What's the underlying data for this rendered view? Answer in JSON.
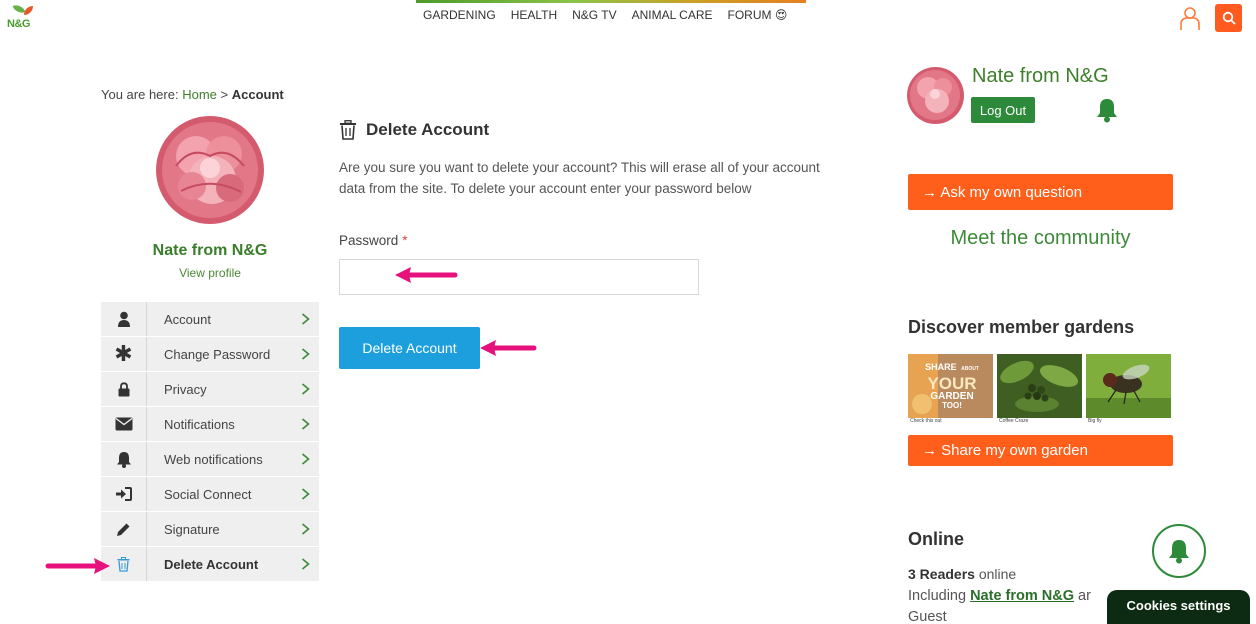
{
  "logo": {
    "text": "N&G"
  },
  "nav": {
    "items": [
      "GARDENING",
      "HEALTH",
      "N&G TV",
      "ANIMAL CARE",
      "FORUM 😍"
    ]
  },
  "breadcrumb": {
    "prefix": "You are here:",
    "home": "Home",
    "separator": ">",
    "current": "Account"
  },
  "profile": {
    "name": "Nate from N&G",
    "view_profile": "View profile"
  },
  "side_menu": [
    {
      "label": "Account",
      "icon": "user-icon"
    },
    {
      "label": "Change Password",
      "icon": "asterisk-icon"
    },
    {
      "label": "Privacy",
      "icon": "lock-icon"
    },
    {
      "label": "Notifications",
      "icon": "envelope-icon"
    },
    {
      "label": "Web notifications",
      "icon": "bell-icon"
    },
    {
      "label": "Social Connect",
      "icon": "sign-in-icon"
    },
    {
      "label": "Signature",
      "icon": "pencil-icon"
    },
    {
      "label": "Delete Account",
      "icon": "trash-icon",
      "active": true
    }
  ],
  "main": {
    "title": "Delete Account",
    "description": "Are you sure you want to delete your account? This will erase all of your account data from the site. To delete your account enter your password below",
    "password_label": "Password",
    "password_required": "*",
    "password_value": "",
    "delete_button": "Delete Account"
  },
  "sidebar": {
    "user_name": "Nate from N&G",
    "logout": "Log Out",
    "ask_question": "→ Ask my own question",
    "meet_community": "Meet the community",
    "discover_title": "Discover member gardens",
    "gallery": [
      {
        "caption": "Check this out",
        "overlay": [
          "SHARE",
          "ABOUT",
          "YOUR",
          "GARDEN",
          "TOO!"
        ]
      },
      {
        "caption": "Coffee Craze"
      },
      {
        "caption": "Big fly"
      }
    ],
    "share_garden": "→ Share my own garden",
    "online_title": "Online",
    "online_count": "3 Readers",
    "online_suffix": "online",
    "including_prefix": "Including",
    "including_user": "Nate from N&G",
    "including_suffix": "ar",
    "guest": "Guest"
  },
  "cookies": "Cookies settings",
  "colors": {
    "brand_green": "#3d7f2a",
    "orange": "#ff5f1a",
    "blue_button": "#1c9fdc",
    "annotation_arrow": "#e6117c"
  }
}
